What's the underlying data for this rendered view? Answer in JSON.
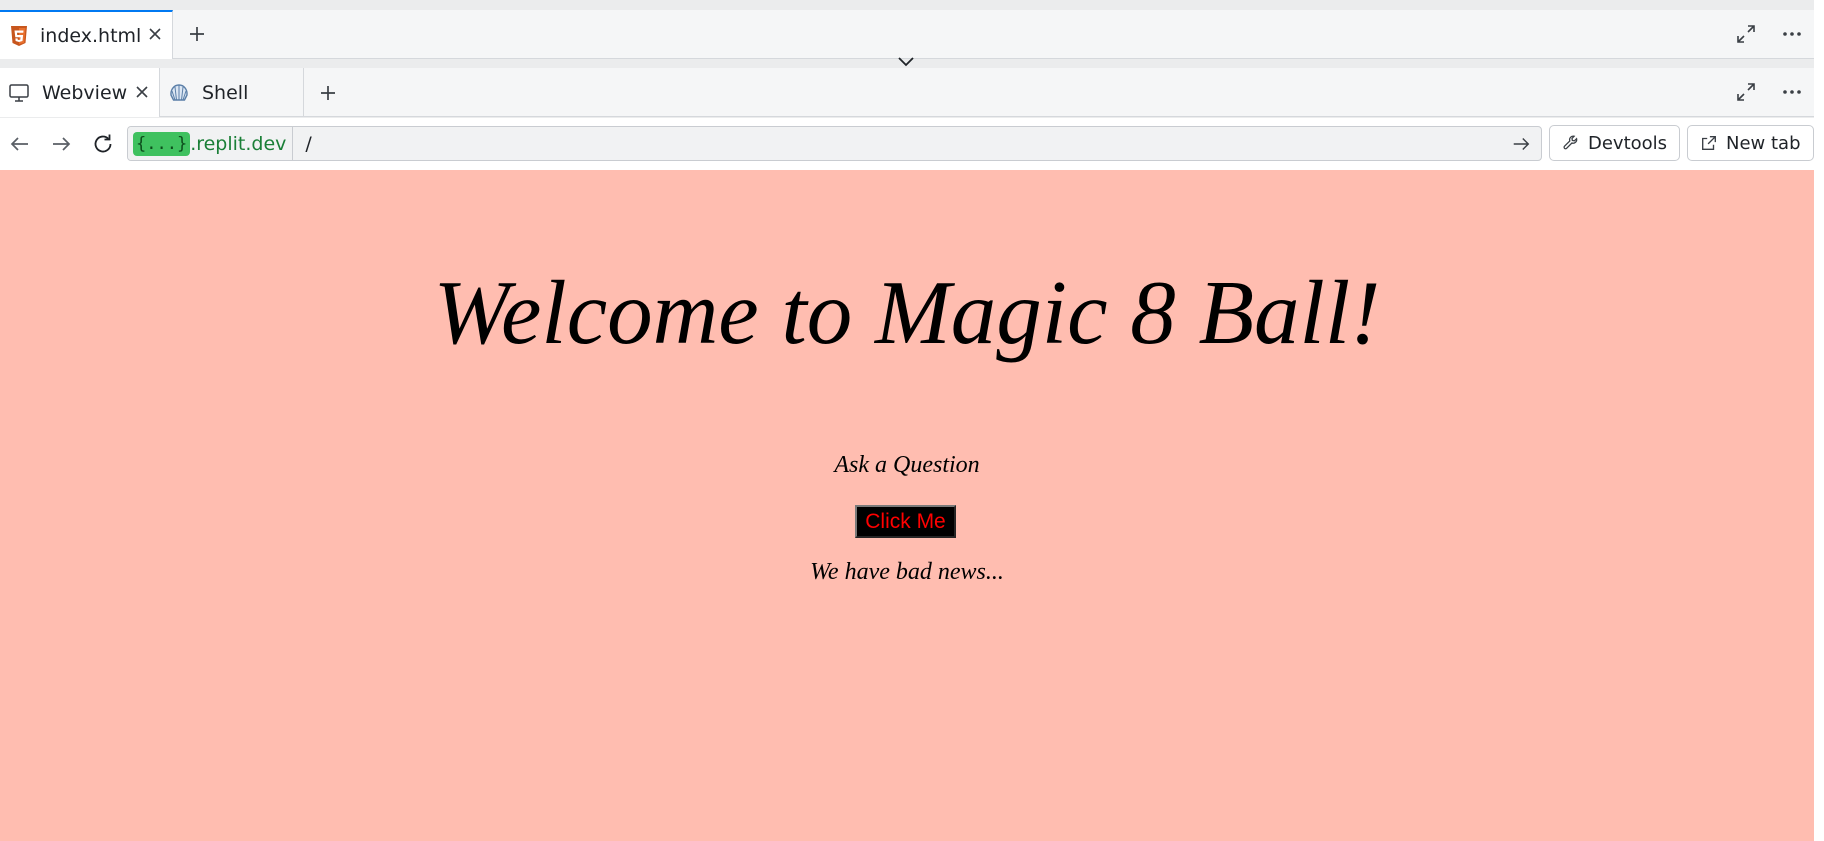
{
  "editor_tabs": {
    "active_tab": {
      "label": "index.html",
      "icon": "html5-icon"
    },
    "add_tab_icon": "plus-icon",
    "actions": [
      "maximize-icon",
      "more-icon"
    ]
  },
  "pane_tabs": {
    "tabs": [
      {
        "label": "Webview",
        "icon": "monitor-icon",
        "closable": true
      },
      {
        "label": "Shell",
        "icon": "shell-icon",
        "closable": false
      }
    ],
    "add_tab_icon": "plus-icon"
  },
  "url_bar": {
    "repl_badge": "{...}",
    "domain": ".replit.dev",
    "path": "/",
    "devtools_label": "Devtools",
    "new_tab_label": "New tab"
  },
  "webview": {
    "background": "#ffbdb0",
    "title": "Welcome to Magic 8 Ball!",
    "prompt": "Ask a Question",
    "button_label": "Click Me",
    "answer": "We have bad news..."
  },
  "colors": {
    "accent": "#0079f2",
    "html5": "#e44d26",
    "repl_badge": "#3fc15f",
    "domain_text": "#1a7f37",
    "button_text": "#ff0000"
  }
}
